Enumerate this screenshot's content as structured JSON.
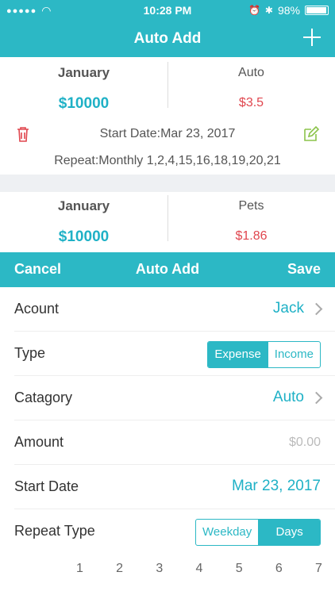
{
  "status": {
    "time": "10:28 PM",
    "battery": "98%"
  },
  "nav": {
    "title": "Auto Add"
  },
  "entries": [
    {
      "month": "January",
      "amount": "$10000",
      "category": "Auto",
      "value": "$3.5",
      "start_date": "Start Date:Mar 23, 2017",
      "repeat": "Repeat:Monthly 1,2,4,15,16,18,19,20,21"
    },
    {
      "month": "January",
      "amount": "$10000",
      "category": "Pets",
      "value": "$1.86"
    }
  ],
  "sheet": {
    "cancel": "Cancel",
    "title": "Auto Add",
    "save": "Save"
  },
  "form": {
    "account_label": "Acount",
    "account_value": "Jack",
    "type_label": "Type",
    "type_options": [
      "Expense",
      "Income"
    ],
    "category_label": "Catagory",
    "category_value": "Auto",
    "amount_label": "Amount",
    "amount_placeholder": "$0.00",
    "start_label": "Start Date",
    "start_value": "Mar 23, 2017",
    "repeat_label": "Repeat Type",
    "repeat_options": [
      "Weekday",
      "Days"
    ]
  },
  "days": [
    "1",
    "2",
    "3",
    "4",
    "5",
    "6",
    "7"
  ],
  "colors": {
    "accent": "#2cb8c5",
    "amount": "#1fb1c6",
    "negative": "#e0464e",
    "edit": "#8bc34a"
  }
}
